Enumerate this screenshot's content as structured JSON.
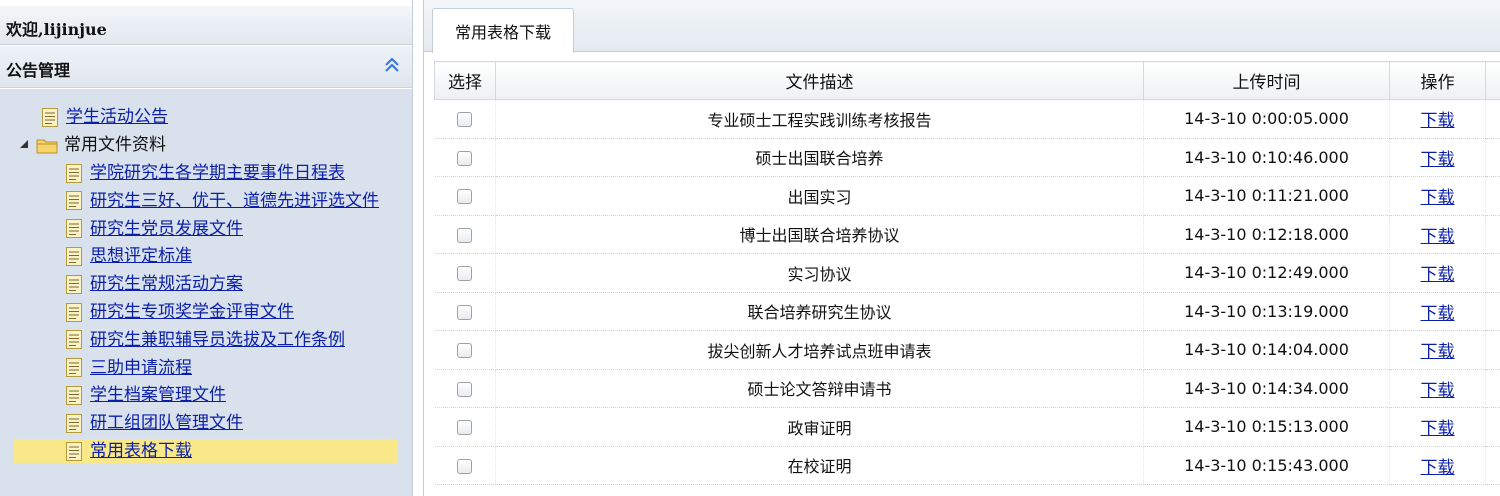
{
  "header": {
    "welcome": "欢迎,lijinjue"
  },
  "sidebar": {
    "section_title": "公告管理",
    "tree": {
      "top_item": "学生活动公告",
      "folder": "常用文件资料",
      "children": [
        "学院研究生各学期主要事件日程表",
        "研究生三好、优干、道德先进评选文件",
        "研究生党员发展文件",
        "思想评定标准",
        "研究生常规活动方案",
        "研究生专项奖学金评审文件",
        "研究生兼职辅导员选拔及工作条例",
        "三助申请流程",
        "学生档案管理文件",
        "研工组团队管理文件",
        "常用表格下载"
      ],
      "selected_index": 10
    }
  },
  "main": {
    "tab_label": "常用表格下载",
    "table": {
      "headers": [
        "选择",
        "文件描述",
        "上传时间",
        "操作"
      ],
      "rows": [
        {
          "desc": "专业硕士工程实践训练考核报告",
          "time": "14-3-10 0:00:05.000",
          "action": "下载"
        },
        {
          "desc": "硕士出国联合培养",
          "time": "14-3-10 0:10:46.000",
          "action": "下载"
        },
        {
          "desc": "出国实习",
          "time": "14-3-10 0:11:21.000",
          "action": "下载"
        },
        {
          "desc": "博士出国联合培养协议",
          "time": "14-3-10 0:12:18.000",
          "action": "下载"
        },
        {
          "desc": "实习协议",
          "time": "14-3-10 0:12:49.000",
          "action": "下载"
        },
        {
          "desc": "联合培养研究生协议",
          "time": "14-3-10 0:13:19.000",
          "action": "下载"
        },
        {
          "desc": "拔尖创新人才培养试点班申请表",
          "time": "14-3-10 0:14:04.000",
          "action": "下载"
        },
        {
          "desc": "硕士论文答辩申请书",
          "time": "14-3-10 0:14:34.000",
          "action": "下载"
        },
        {
          "desc": "政审证明",
          "time": "14-3-10 0:15:13.000",
          "action": "下载"
        },
        {
          "desc": "在校证明",
          "time": "14-3-10 0:15:43.000",
          "action": "下载"
        }
      ]
    }
  },
  "colors": {
    "link": "#0b1fa8",
    "tree_bg": "#d8e1ec",
    "selected_bg": "#f9e88a",
    "icon_blue": "#3a7bd5"
  },
  "icons": {
    "collapse": "double-chevron-up-icon",
    "document": "document-icon",
    "folder": "folder-icon",
    "expand_toggle": "triangle-expanded-icon"
  }
}
